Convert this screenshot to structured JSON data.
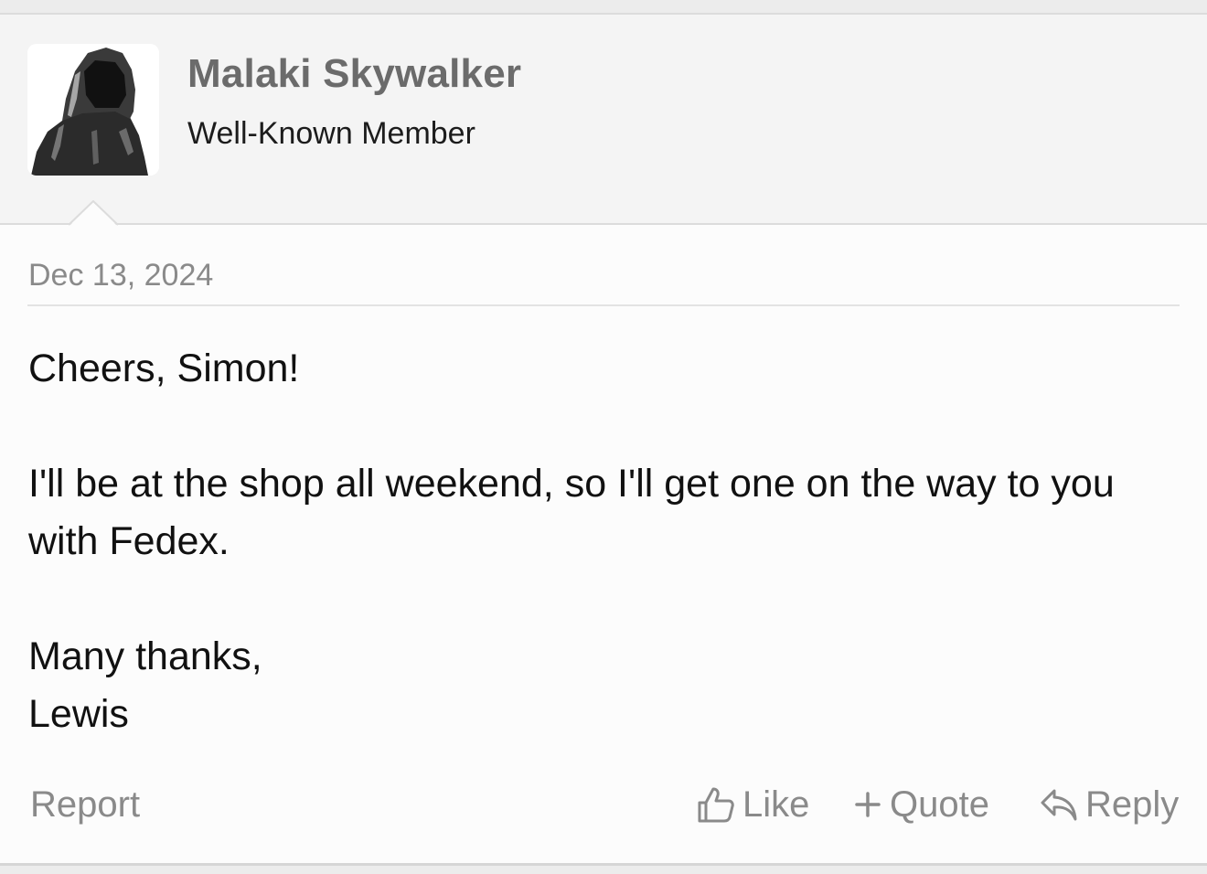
{
  "post": {
    "author": {
      "name": "Malaki Skywalker",
      "title": "Well-Known Member",
      "avatar_icon": "hooded-figure-avatar"
    },
    "date": "Dec 13, 2024",
    "message": {
      "line1": "Cheers, Simon!",
      "line2": "I'll be at the shop all weekend, so I'll get one on the way to you with Fedex.",
      "line3": "Many thanks,",
      "line4": "Lewis"
    },
    "actions": {
      "report": "Report",
      "like": "Like",
      "like_icon": "thumbs-up-icon",
      "quote": "Quote",
      "quote_icon": "plus-icon",
      "reply": "Reply",
      "reply_icon": "reply-arrow-icon"
    }
  },
  "colors": {
    "header_bg": "#f4f4f4",
    "body_bg": "#fcfcfc",
    "muted_text": "#8a8a8a",
    "username": "#6b6b6b"
  }
}
